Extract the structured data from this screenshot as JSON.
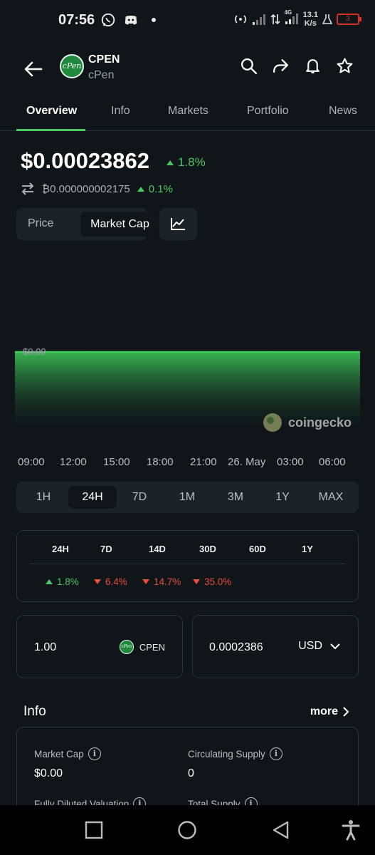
{
  "status_bar": {
    "time": "07:56",
    "net_type": "4G",
    "net_speed": "13.1",
    "net_unit": "K/s",
    "battery": "3"
  },
  "header": {
    "coin_symbol": "CPEN",
    "coin_name": "cPen",
    "logo_text": "cPen"
  },
  "tabs": [
    {
      "label": "Overview",
      "active": true
    },
    {
      "label": "Info"
    },
    {
      "label": "Markets"
    },
    {
      "label": "Portfolio"
    },
    {
      "label": "News"
    }
  ],
  "price": {
    "usd": "$0.00023862",
    "usd_change": "1.8%",
    "btc": "₿0.000000002175",
    "btc_change": "0.1%"
  },
  "chart_toggle": {
    "price_label": "Price",
    "market_cap_label": "Market Cap",
    "selected": "Market Cap"
  },
  "chart_data": {
    "type": "area",
    "y_label_value": "$0.00",
    "x_ticks": [
      "09:00",
      "12:00",
      "15:00",
      "18:00",
      "21:00",
      "26. May",
      "03:00",
      "06:00"
    ],
    "values": [
      0,
      0,
      0,
      0,
      0,
      0,
      0,
      0
    ],
    "watermark": "coingecko",
    "color": "#3ecf5a"
  },
  "ranges": [
    "1H",
    "24H",
    "7D",
    "1M",
    "3M",
    "1Y",
    "MAX"
  ],
  "active_range": "24H",
  "performance": {
    "headers": [
      "24H",
      "7D",
      "14D",
      "30D",
      "60D",
      "1Y"
    ],
    "values": [
      {
        "text": "1.8%",
        "dir": "up"
      },
      {
        "text": "6.4%",
        "dir": "down"
      },
      {
        "text": "14.7%",
        "dir": "down"
      },
      {
        "text": "35.0%",
        "dir": "down"
      }
    ]
  },
  "converter": {
    "amount": "1.00",
    "coin": "CPEN",
    "value": "0.0002386",
    "currency": "USD"
  },
  "info": {
    "title": "Info",
    "more": "more",
    "market_cap_label": "Market Cap",
    "market_cap_value": "$0.00",
    "circ_supply_label": "Circulating Supply",
    "circ_supply_value": "0",
    "fdv_label": "Fully Diluted Valuation",
    "total_supply_label": "Total Supply"
  }
}
